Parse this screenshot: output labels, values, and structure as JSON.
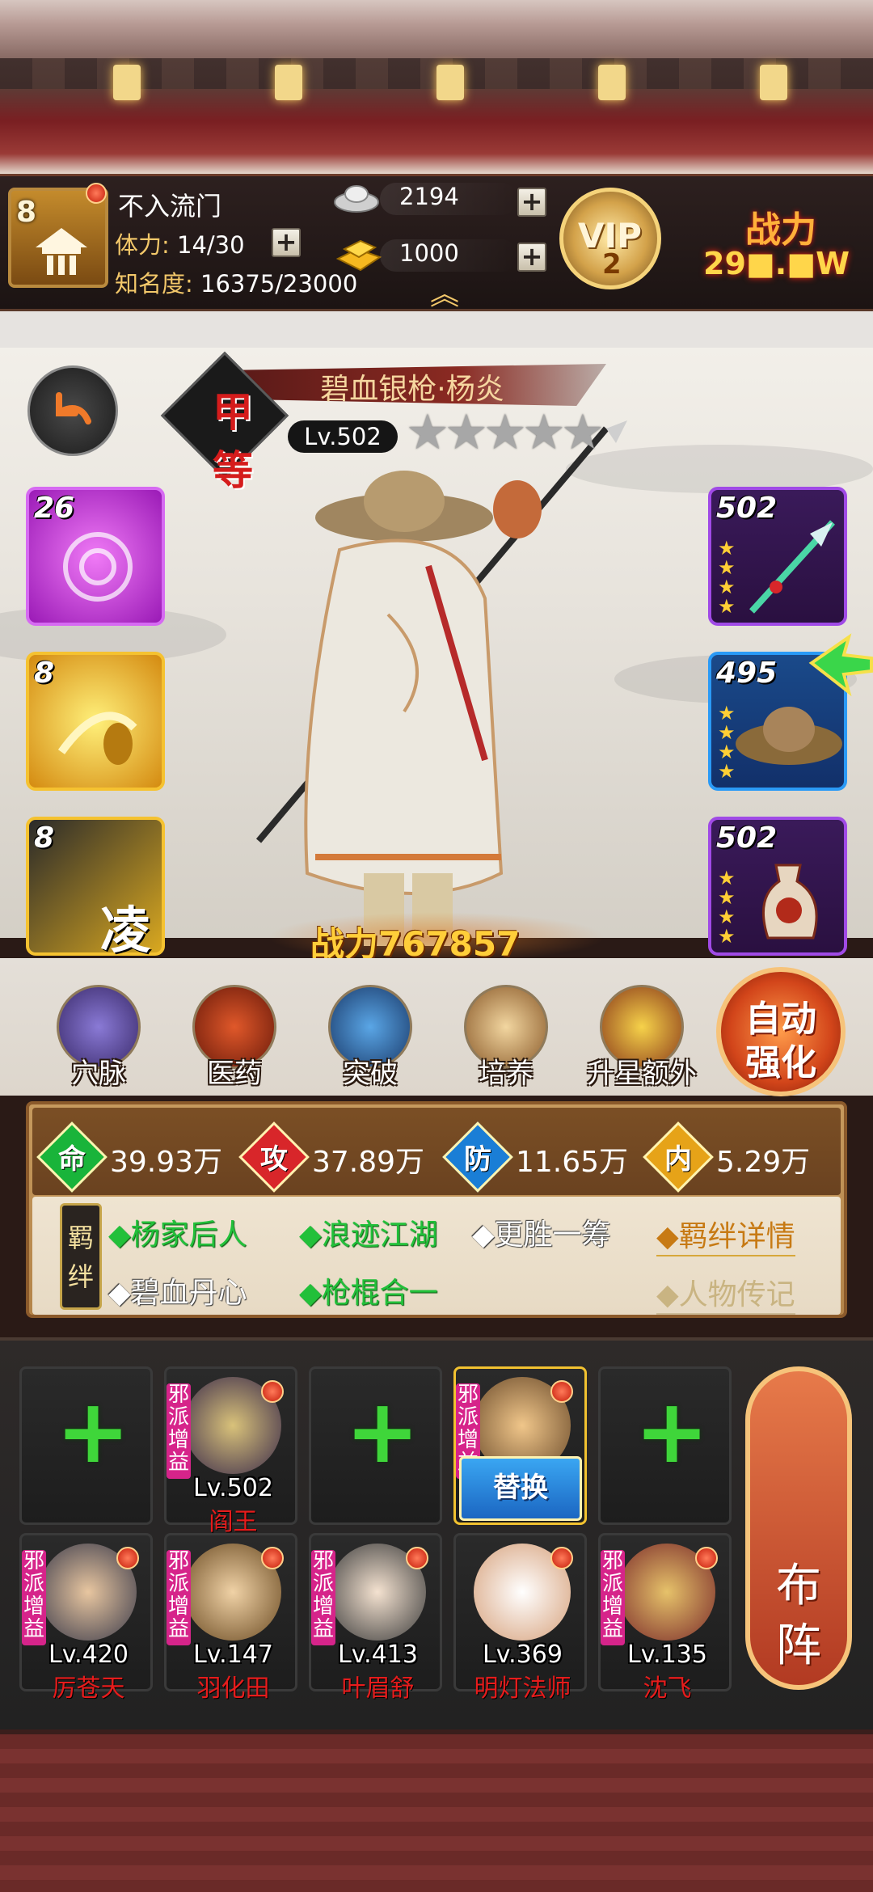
{
  "player": {
    "rank_level": "8",
    "name": "不入流门",
    "stamina_label": "体力:",
    "stamina_value": "14/30",
    "fame_label": "知名度:",
    "fame_value": "16375/23000"
  },
  "currency": {
    "silver": "2194",
    "gold": "1000"
  },
  "vip": {
    "label": "VIP",
    "level": "2"
  },
  "top_power": {
    "label": "战力",
    "value": "29■.■W"
  },
  "hero": {
    "grade": "甲等",
    "name": "碧血银枪·杨炎",
    "level": "Lv.502",
    "stars_total": 5,
    "stars_filled": 0,
    "power_label": "战力",
    "power_value": "767857"
  },
  "skills": [
    {
      "level": "26",
      "color": "#b22ad6"
    },
    {
      "level": "8",
      "color": "#e7b21a"
    },
    {
      "level": "8",
      "color": "#d39a10",
      "glyph": "凌"
    }
  ],
  "equipment": [
    {
      "level": "502",
      "stars": 4,
      "frame": "#6a2ad6",
      "icon": "spear-icon"
    },
    {
      "level": "495",
      "stars": 4,
      "frame": "#1a7ae6",
      "icon": "hat-icon"
    },
    {
      "level": "502",
      "stars": 4,
      "frame": "#6a2ad6",
      "icon": "vase-icon"
    }
  ],
  "actions": [
    {
      "label": "穴脉",
      "icon": "meridian-icon"
    },
    {
      "label": "医药",
      "icon": "medicine-icon"
    },
    {
      "label": "突破",
      "icon": "breakthrough-icon"
    },
    {
      "label": "培养",
      "icon": "training-icon"
    },
    {
      "label": "升星额外",
      "icon": "star-upgrade-icon"
    }
  ],
  "auto_enhance": {
    "line1": "自动",
    "line2": "强化"
  },
  "stats": [
    {
      "key": "命",
      "value": "39.93万",
      "color": "#19b43a"
    },
    {
      "key": "攻",
      "value": "37.89万",
      "color": "#d8262a"
    },
    {
      "key": "防",
      "value": "11.65万",
      "color": "#1a7ed6"
    },
    {
      "key": "内",
      "value": "5.29万",
      "color": "#e6a318"
    }
  ],
  "bonds": {
    "tag": "羁绊",
    "items": [
      {
        "text": "◆杨家后人",
        "active": true
      },
      {
        "text": "◆浪迹江湖",
        "active": true
      },
      {
        "text": "◆更胜一筹",
        "active": false
      },
      {
        "text": "◆碧血丹心",
        "active": false
      },
      {
        "text": "◆枪棍合一",
        "active": true
      }
    ],
    "detail_link": "◆羁绊详情",
    "bio_link": "◆人物传记"
  },
  "team": {
    "slot_tag": "邪派增益",
    "replace_label": "替换",
    "row1": [
      {
        "empty": true
      },
      {
        "empty": false,
        "level": "Lv.502",
        "name": "阎王"
      },
      {
        "empty": true
      },
      {
        "empty": false,
        "active": true
      },
      {
        "empty": true
      }
    ],
    "row2": [
      {
        "level": "Lv.420",
        "name": "厉苍天",
        "tag": true
      },
      {
        "level": "Lv.147",
        "name": "羽化田",
        "tag": true
      },
      {
        "level": "Lv.413",
        "name": "叶眉舒",
        "tag": true
      },
      {
        "level": "Lv.369",
        "name": "明灯法师",
        "tag": false
      },
      {
        "level": "Lv.135",
        "name": "沈飞",
        "tag": true
      }
    ],
    "formation_line1": "布",
    "formation_line2": "阵"
  }
}
